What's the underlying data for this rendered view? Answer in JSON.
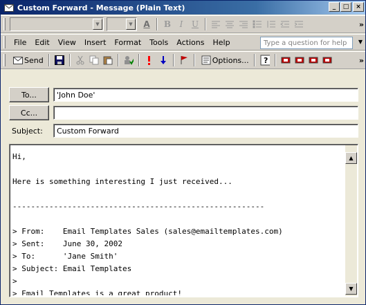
{
  "window": {
    "title": "Custom Forward - Message (Plain Text)",
    "controls": {
      "minimize": "_",
      "maximize": "□",
      "close": "×"
    }
  },
  "format_toolbar": {
    "font_name_value": "",
    "font_size_value": "",
    "bold_label": "B",
    "italic_label": "I",
    "underline_label": "U",
    "font_color_label": "A"
  },
  "menu": {
    "items": [
      {
        "label": "File"
      },
      {
        "label": "Edit"
      },
      {
        "label": "View"
      },
      {
        "label": "Insert"
      },
      {
        "label": "Format"
      },
      {
        "label": "Tools"
      },
      {
        "label": "Actions"
      },
      {
        "label": "Help"
      }
    ],
    "help_placeholder": "Type a question for help"
  },
  "std_toolbar": {
    "send_label": "Send",
    "options_label": "Options...",
    "colors": {
      "importance_high": "#ff0000",
      "importance_low": "#0000c0",
      "flag": "#c00000"
    }
  },
  "header": {
    "to_button": "To...",
    "to_value": "'John Doe'",
    "cc_button": "Cc...",
    "cc_value": "",
    "subject_label": "Subject:",
    "subject_value": "Custom Forward"
  },
  "body": {
    "lines": [
      "Hi,",
      "",
      "Here is something interesting I just received...",
      "",
      "-------------------------------------------------------",
      "",
      "> From:    Email Templates Sales (sales@emailtemplates.com)",
      "> Sent:    June 30, 2002",
      "> To:      'Jane Smith'",
      "> Subject: Email Templates",
      ">",
      "> Email Templates is a great product!"
    ]
  }
}
